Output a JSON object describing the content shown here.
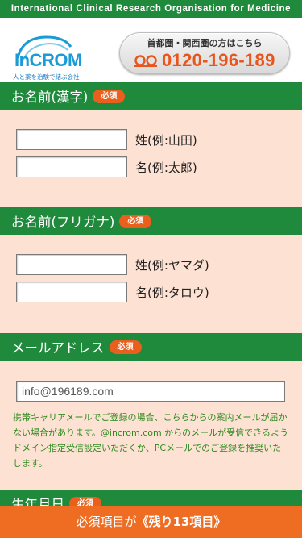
{
  "banner": {
    "text": "International Clinical Research Organisation for Medicine"
  },
  "logo": {
    "name": "InCROM",
    "tagline": "人と薬を治験で結ぶ会社"
  },
  "contact": {
    "caption": "首都圏・関西圏の方はこちら",
    "freedial_icon": "freedial-icon",
    "phone": "0120-196-189"
  },
  "sections": {
    "name_kanji": {
      "title": "お名前(漢字)",
      "badge": "必須",
      "fields": [
        {
          "label": "姓(例:山田)",
          "value": ""
        },
        {
          "label": "名(例:太郎)",
          "value": ""
        }
      ]
    },
    "name_kana": {
      "title": "お名前(フリガナ)",
      "badge": "必須",
      "fields": [
        {
          "label": "姓(例:ヤマダ)",
          "value": ""
        },
        {
          "label": "名(例:タロウ)",
          "value": ""
        }
      ]
    },
    "email": {
      "title": "メールアドレス",
      "badge": "必須",
      "placeholder": "info@196189.com",
      "note": "携帯キャリアメールでご登録の場合、こちらからの案内メールが届かない場合があります。@incrom.com からのメールが受信できるようドメイン指定受信設定いただくか、PCメールでのご登録を推奨いたします。"
    },
    "birth": {
      "title": "生年月日",
      "badge": "必須"
    }
  },
  "footer": {
    "prefix": "必須項目が",
    "count": "《残り13項目》"
  },
  "colors": {
    "green": "#1f8a3c",
    "orange": "#e9601e",
    "blue": "#1a9ad6",
    "note_green": "#2d8a1e"
  }
}
